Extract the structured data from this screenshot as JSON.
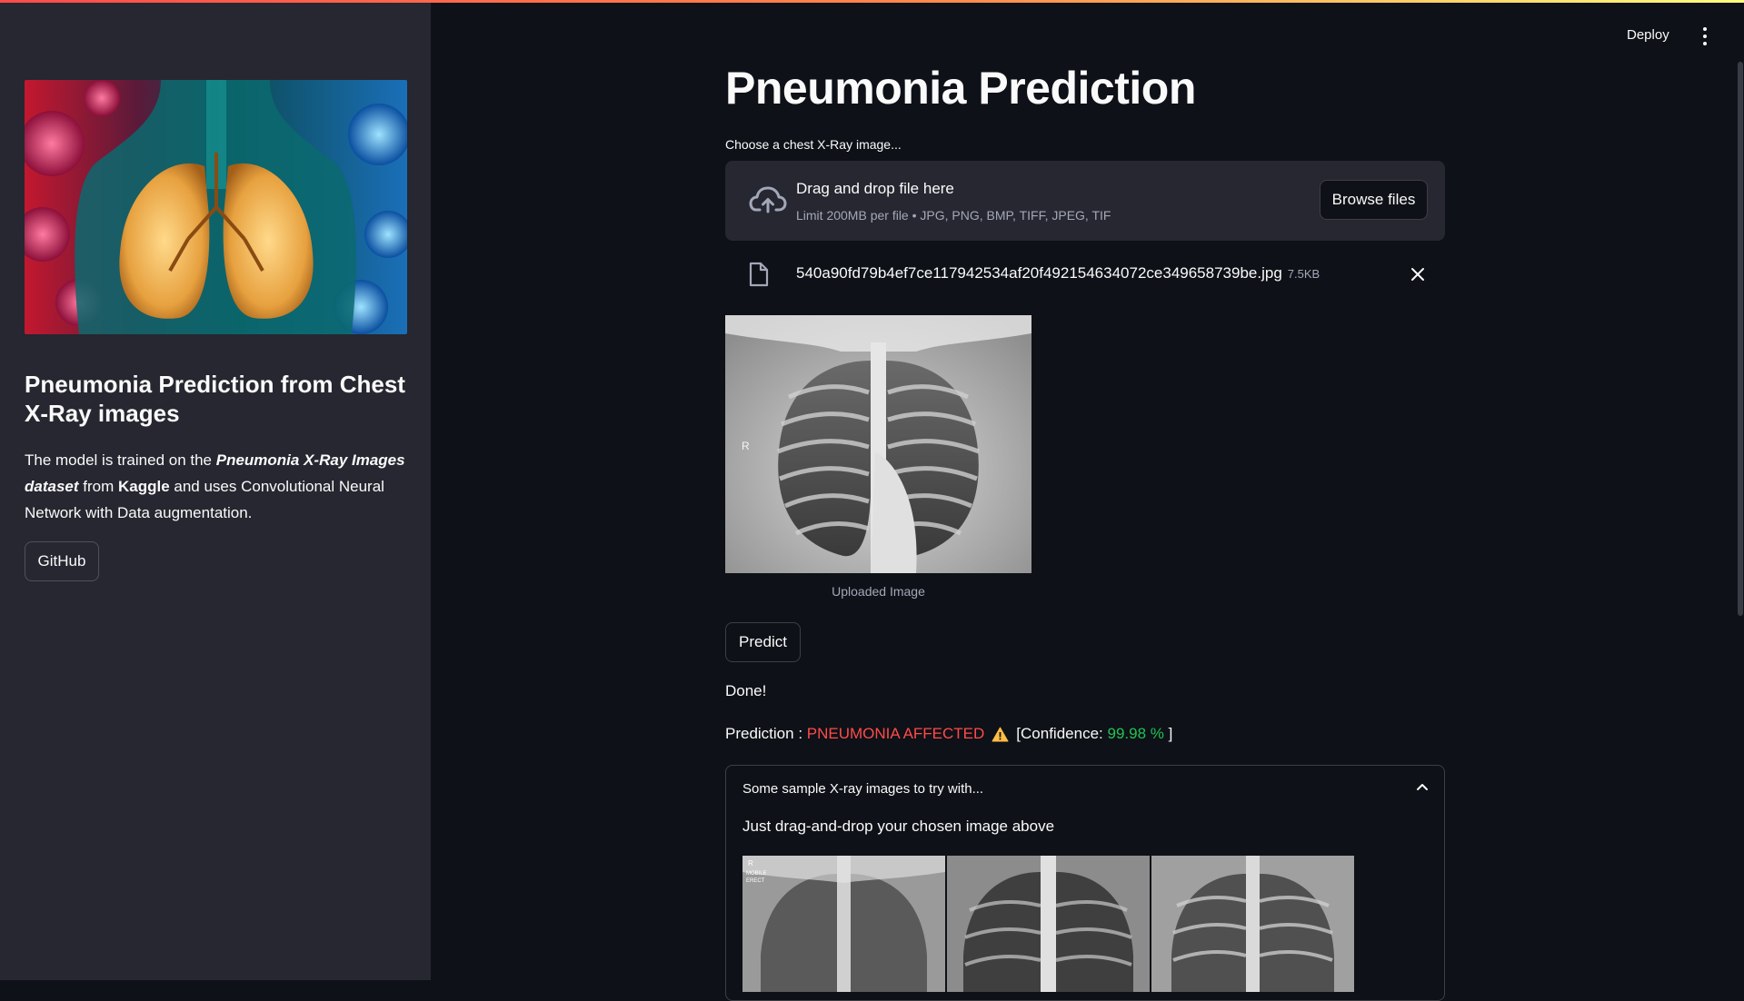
{
  "header": {
    "deploy_label": "Deploy",
    "menu_icon": "kebab-menu-icon"
  },
  "sidebar": {
    "hero_image_alt": "lungs-illustration",
    "title": "Pneumonia Prediction from Chest X-Ray images",
    "desc": {
      "p1": "The model is trained on the ",
      "p2": "Pneumonia X-Ray Images dataset",
      "p3": " from ",
      "p4": "Kaggle",
      "p5": " and uses Convolutional Neural Network with Data augmentation."
    },
    "github_label": "GitHub"
  },
  "main": {
    "title": "Pneumonia Prediction",
    "uploader": {
      "label": "Choose a chest X-Ray image...",
      "drop_title": "Drag and drop file here",
      "limit": "Limit 200MB per file • JPG, PNG, BMP, TIFF, JPEG, TIF",
      "browse_label": "Browse files"
    },
    "file": {
      "name": "540a90fd79b4ef7ce117942534af20f492154634072ce349658739be.jpg",
      "size": "7.5KB"
    },
    "image_caption": "Uploaded Image",
    "predict_label": "Predict",
    "done_text": "Done!",
    "prediction": {
      "prefix": "Prediction : ",
      "result": "PNEUMONIA AFFECTED",
      "conf_prefix": "[Confidence: ",
      "conf_value": "99.98 %",
      "conf_suffix": " ]"
    },
    "samples": {
      "title": "Some sample X-ray images to try with...",
      "text": "Just drag-and-drop your chosen image above",
      "overlay_marks": [
        "R",
        "MOBILE",
        "ERECT"
      ]
    }
  },
  "colors": {
    "background": "#0e1117",
    "sidebar": "#262730",
    "danger": "#ff4b4b",
    "success": "#21c354",
    "warning": "#ffbd45"
  }
}
